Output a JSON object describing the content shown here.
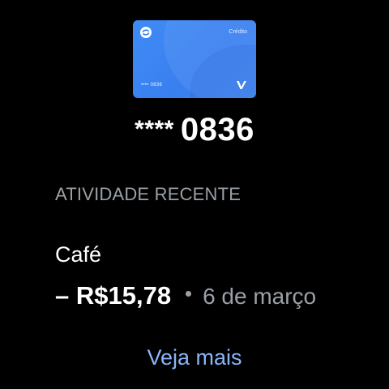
{
  "card": {
    "type_label": "Crédito",
    "mini_number": "•••• 0836",
    "logo_icon": "wallet-logo-icon",
    "brand_icon": "card-brand-v-icon",
    "colors": {
      "card_background": "#3b82f0"
    }
  },
  "card_number": {
    "mask": "****",
    "last_digits": "0836"
  },
  "activity": {
    "section_title": "ATIVIDADE RECENTE",
    "items": [
      {
        "merchant": "Café",
        "amount": "– R$15,78",
        "date": "6 de março"
      }
    ]
  },
  "actions": {
    "see_more_label": "Veja mais"
  },
  "colors": {
    "background": "#000000",
    "primary_text": "#ffffff",
    "secondary_text": "#9aa0a6",
    "accent": "#8ab4f8"
  }
}
